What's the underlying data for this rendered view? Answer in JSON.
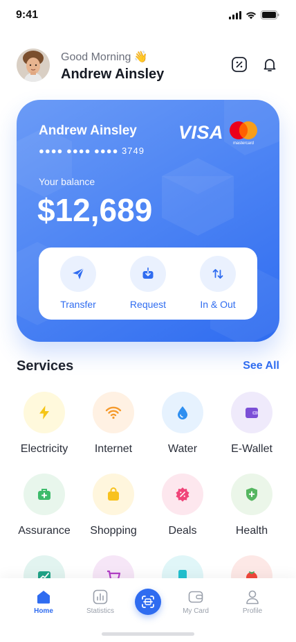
{
  "status_bar": {
    "time": "9:41"
  },
  "header": {
    "greeting": "Good Morning 👋",
    "user_name": "Andrew Ainsley"
  },
  "card": {
    "holder_name": "Andrew Ainsley",
    "number_masked": "●●●● ●●●● ●●●● 3749",
    "brand": "VISA",
    "mastercard_text": "mastercard",
    "balance_label": "Your balance",
    "balance": "$12,689",
    "accent_color": "#4f86f4",
    "actions": [
      {
        "label": "Transfer",
        "icon": "paper-plane-icon"
      },
      {
        "label": "Request",
        "icon": "download-box-icon"
      },
      {
        "label": "In & Out",
        "icon": "up-down-arrows-icon"
      }
    ]
  },
  "services": {
    "title": "Services",
    "see_all": "See All",
    "items": [
      {
        "label": "Electricity",
        "icon": "lightning-icon",
        "bg": "#fff9dc",
        "color": "#f5c518"
      },
      {
        "label": "Internet",
        "icon": "wifi-icon",
        "bg": "#fff1e3",
        "color": "#f59a2c"
      },
      {
        "label": "Water",
        "icon": "water-drop-icon",
        "bg": "#e6f2fe",
        "color": "#2f8ff0"
      },
      {
        "label": "E-Wallet",
        "icon": "wallet-icon",
        "bg": "#efeafb",
        "color": "#7b4fd6"
      },
      {
        "label": "Assurance",
        "icon": "briefcase-medical-icon",
        "bg": "#e8f6ec",
        "color": "#3dbb6b"
      },
      {
        "label": "Shopping",
        "icon": "shopping-bag-icon",
        "bg": "#fff6dd",
        "color": "#f8c21f"
      },
      {
        "label": "Deals",
        "icon": "discount-badge-icon",
        "bg": "#fde7ee",
        "color": "#f0457a"
      },
      {
        "label": "Health",
        "icon": "shield-plus-icon",
        "bg": "#ebf6e9",
        "color": "#55b660"
      }
    ],
    "partial_row_icons": [
      {
        "icon": "chart-image-icon",
        "bg": "#e2f4f0",
        "color": "#1fa387"
      },
      {
        "icon": "cart-icon",
        "bg": "#f6e6f7",
        "color": "#b13ec6"
      },
      {
        "icon": "phone-icon",
        "bg": "#e0f6f8",
        "color": "#22c1cf"
      },
      {
        "icon": "tomato-icon",
        "bg": "#fde8e6",
        "color": "#f0473b"
      }
    ]
  },
  "bottom_nav": {
    "items": [
      {
        "label": "Home",
        "icon": "home-icon",
        "active": true
      },
      {
        "label": "Statistics",
        "icon": "chart-bars-icon",
        "active": false
      },
      {
        "label": "My Card",
        "icon": "wallet-card-icon",
        "active": false
      },
      {
        "label": "Profile",
        "icon": "user-icon",
        "active": false
      }
    ],
    "center_icon": "scan-icon"
  }
}
